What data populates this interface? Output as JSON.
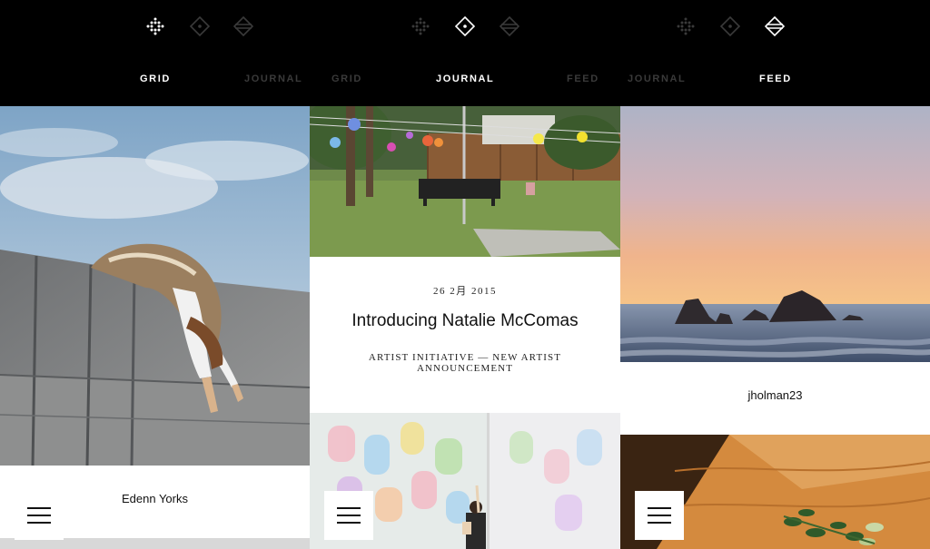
{
  "tabs": {
    "screen1": {
      "active": "GRID",
      "right": "JOURNAL"
    },
    "screen2": {
      "left": "GRID",
      "active": "JOURNAL",
      "right": "FEED"
    },
    "screen3": {
      "left": "JOURNAL",
      "active": "FEED"
    }
  },
  "icons": [
    "grid-dots-icon",
    "diamond-dot-icon",
    "diamond-split-icon"
  ],
  "grid": {
    "artist_name": "Edenn Yorks"
  },
  "journal": {
    "date": "26 2月 2015",
    "title": "Introducing Natalie McComas",
    "tags": "ARTIST INITIATIVE — NEW ARTIST ANNOUNCEMENT"
  },
  "feed": {
    "username": "jholman23"
  },
  "colors": {
    "background": "#000000",
    "active_nav": "#ffffff",
    "dim_nav": "#3a3a3a",
    "card": "#ffffff"
  }
}
